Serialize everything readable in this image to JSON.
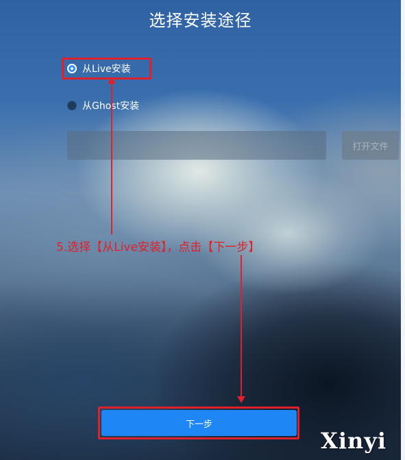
{
  "dialog": {
    "title": "选择安装途径"
  },
  "options": {
    "live_label": "从Live安装",
    "live_selected": true,
    "ghost_label": "从Ghost安装",
    "ghost_selected": false
  },
  "file": {
    "path_value": "",
    "open_button_label": "打开文件"
  },
  "footer": {
    "next_button_label": "下一步"
  },
  "annotation": {
    "text": "5.选择【从Live安装】，点击【下一步】",
    "color": "#e0202a"
  },
  "watermark": {
    "text": "Xinyi"
  },
  "colors": {
    "accent": "#1e86f5",
    "annotation": "#e0202a"
  }
}
